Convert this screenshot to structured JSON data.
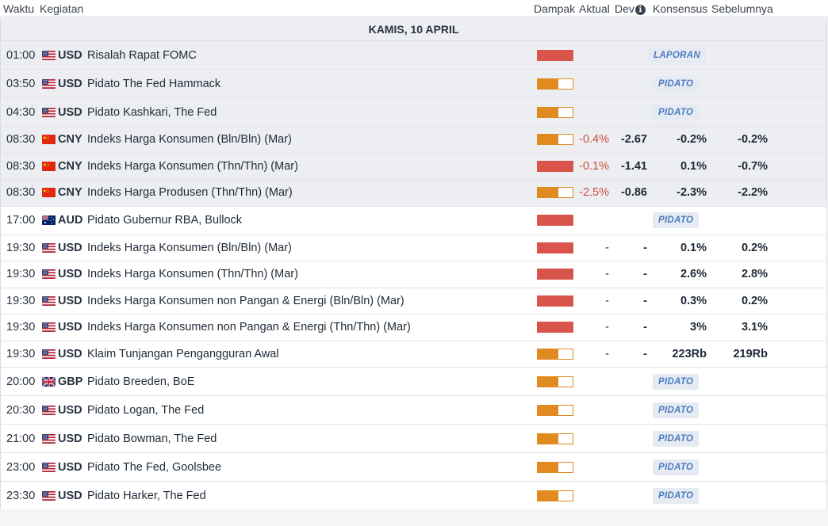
{
  "header": {
    "time": "Waktu",
    "event": "Kegiatan",
    "impact": "Dampak",
    "actual": "Aktual",
    "dev": "Dev",
    "consensus": "Konsensus",
    "previous": "Sebelumnya"
  },
  "day_label": "KAMIS, 10 APRIL",
  "colors": {
    "high": "#d9544a",
    "medium": "#e08a1f",
    "negative": "#d14b40",
    "badge_text": "#4a7bc0"
  },
  "rows": [
    {
      "time": "01:00",
      "cur": "USD",
      "flag": "us-flag-icon",
      "event": "Risalah Rapat FOMC",
      "impact": "high",
      "badge": "LAPORAN",
      "past": true
    },
    {
      "time": "03:50",
      "cur": "USD",
      "flag": "us-flag-icon",
      "event": "Pidato The Fed Hammack",
      "impact": "medium",
      "badge": "PIDATO",
      "past": true
    },
    {
      "time": "04:30",
      "cur": "USD",
      "flag": "us-flag-icon",
      "event": "Pidato Kashkari, The Fed",
      "impact": "medium",
      "badge": "PIDATO",
      "past": true
    },
    {
      "time": "08:30",
      "cur": "CNY",
      "flag": "cn-flag-icon",
      "event": "Indeks Harga Konsumen (Bln/Bln) (Mar)",
      "impact": "medium",
      "actual": "-0.4%",
      "dev": "-2.67",
      "cons": "-0.2%",
      "prev": "-0.2%",
      "past": true
    },
    {
      "time": "08:30",
      "cur": "CNY",
      "flag": "cn-flag-icon",
      "event": "Indeks Harga Konsumen (Thn/Thn) (Mar)",
      "impact": "high",
      "actual": "-0.1%",
      "dev": "-1.41",
      "cons": "0.1%",
      "prev": "-0.7%",
      "past": true
    },
    {
      "time": "08:30",
      "cur": "CNY",
      "flag": "cn-flag-icon",
      "event": "Indeks Harga Produsen (Thn/Thn) (Mar)",
      "impact": "medium",
      "actual": "-2.5%",
      "dev": "-0.86",
      "cons": "-2.3%",
      "prev": "-2.2%",
      "past": true
    },
    {
      "time": "17:00",
      "cur": "AUD",
      "flag": "au-flag-icon",
      "event": "Pidato Gubernur RBA, Bullock",
      "impact": "high",
      "badge": "PIDATO",
      "past": false
    },
    {
      "time": "19:30",
      "cur": "USD",
      "flag": "us-flag-icon",
      "event": "Indeks Harga Konsumen (Bln/Bln) (Mar)",
      "impact": "high",
      "actual": "-",
      "dev": "-",
      "cons": "0.1%",
      "prev": "0.2%",
      "past": false
    },
    {
      "time": "19:30",
      "cur": "USD",
      "flag": "us-flag-icon",
      "event": "Indeks Harga Konsumen (Thn/Thn) (Mar)",
      "impact": "high",
      "actual": "-",
      "dev": "-",
      "cons": "2.6%",
      "prev": "2.8%",
      "past": false
    },
    {
      "time": "19:30",
      "cur": "USD",
      "flag": "us-flag-icon",
      "event": "Indeks Harga Konsumen non Pangan & Energi (Bln/Bln) (Mar)",
      "impact": "high",
      "actual": "-",
      "dev": "-",
      "cons": "0.3%",
      "prev": "0.2%",
      "past": false
    },
    {
      "time": "19:30",
      "cur": "USD",
      "flag": "us-flag-icon",
      "event": "Indeks Harga Konsumen non Pangan & Energi (Thn/Thn) (Mar)",
      "impact": "high",
      "actual": "-",
      "dev": "-",
      "cons": "3%",
      "prev": "3.1%",
      "past": false
    },
    {
      "time": "19:30",
      "cur": "USD",
      "flag": "us-flag-icon",
      "event": "Klaim Tunjangan Pengangguran Awal",
      "impact": "medium",
      "actual": "-",
      "dev": "-",
      "cons": "223Rb",
      "prev": "219Rb",
      "past": false
    },
    {
      "time": "20:00",
      "cur": "GBP",
      "flag": "gb-flag-icon",
      "event": "Pidato Breeden, BoE",
      "impact": "medium",
      "badge": "PIDATO",
      "past": false
    },
    {
      "time": "20:30",
      "cur": "USD",
      "flag": "us-flag-icon",
      "event": "Pidato Logan, The Fed",
      "impact": "medium",
      "badge": "PIDATO",
      "past": false
    },
    {
      "time": "21:00",
      "cur": "USD",
      "flag": "us-flag-icon",
      "event": "Pidato Bowman, The Fed",
      "impact": "medium",
      "badge": "PIDATO",
      "past": false
    },
    {
      "time": "23:00",
      "cur": "USD",
      "flag": "us-flag-icon",
      "event": "Pidato The Fed, Goolsbee",
      "impact": "medium",
      "badge": "PIDATO",
      "past": false
    },
    {
      "time": "23:30",
      "cur": "USD",
      "flag": "us-flag-icon",
      "event": "Pidato Harker, The Fed",
      "impact": "medium",
      "badge": "PIDATO",
      "past": false
    }
  ]
}
